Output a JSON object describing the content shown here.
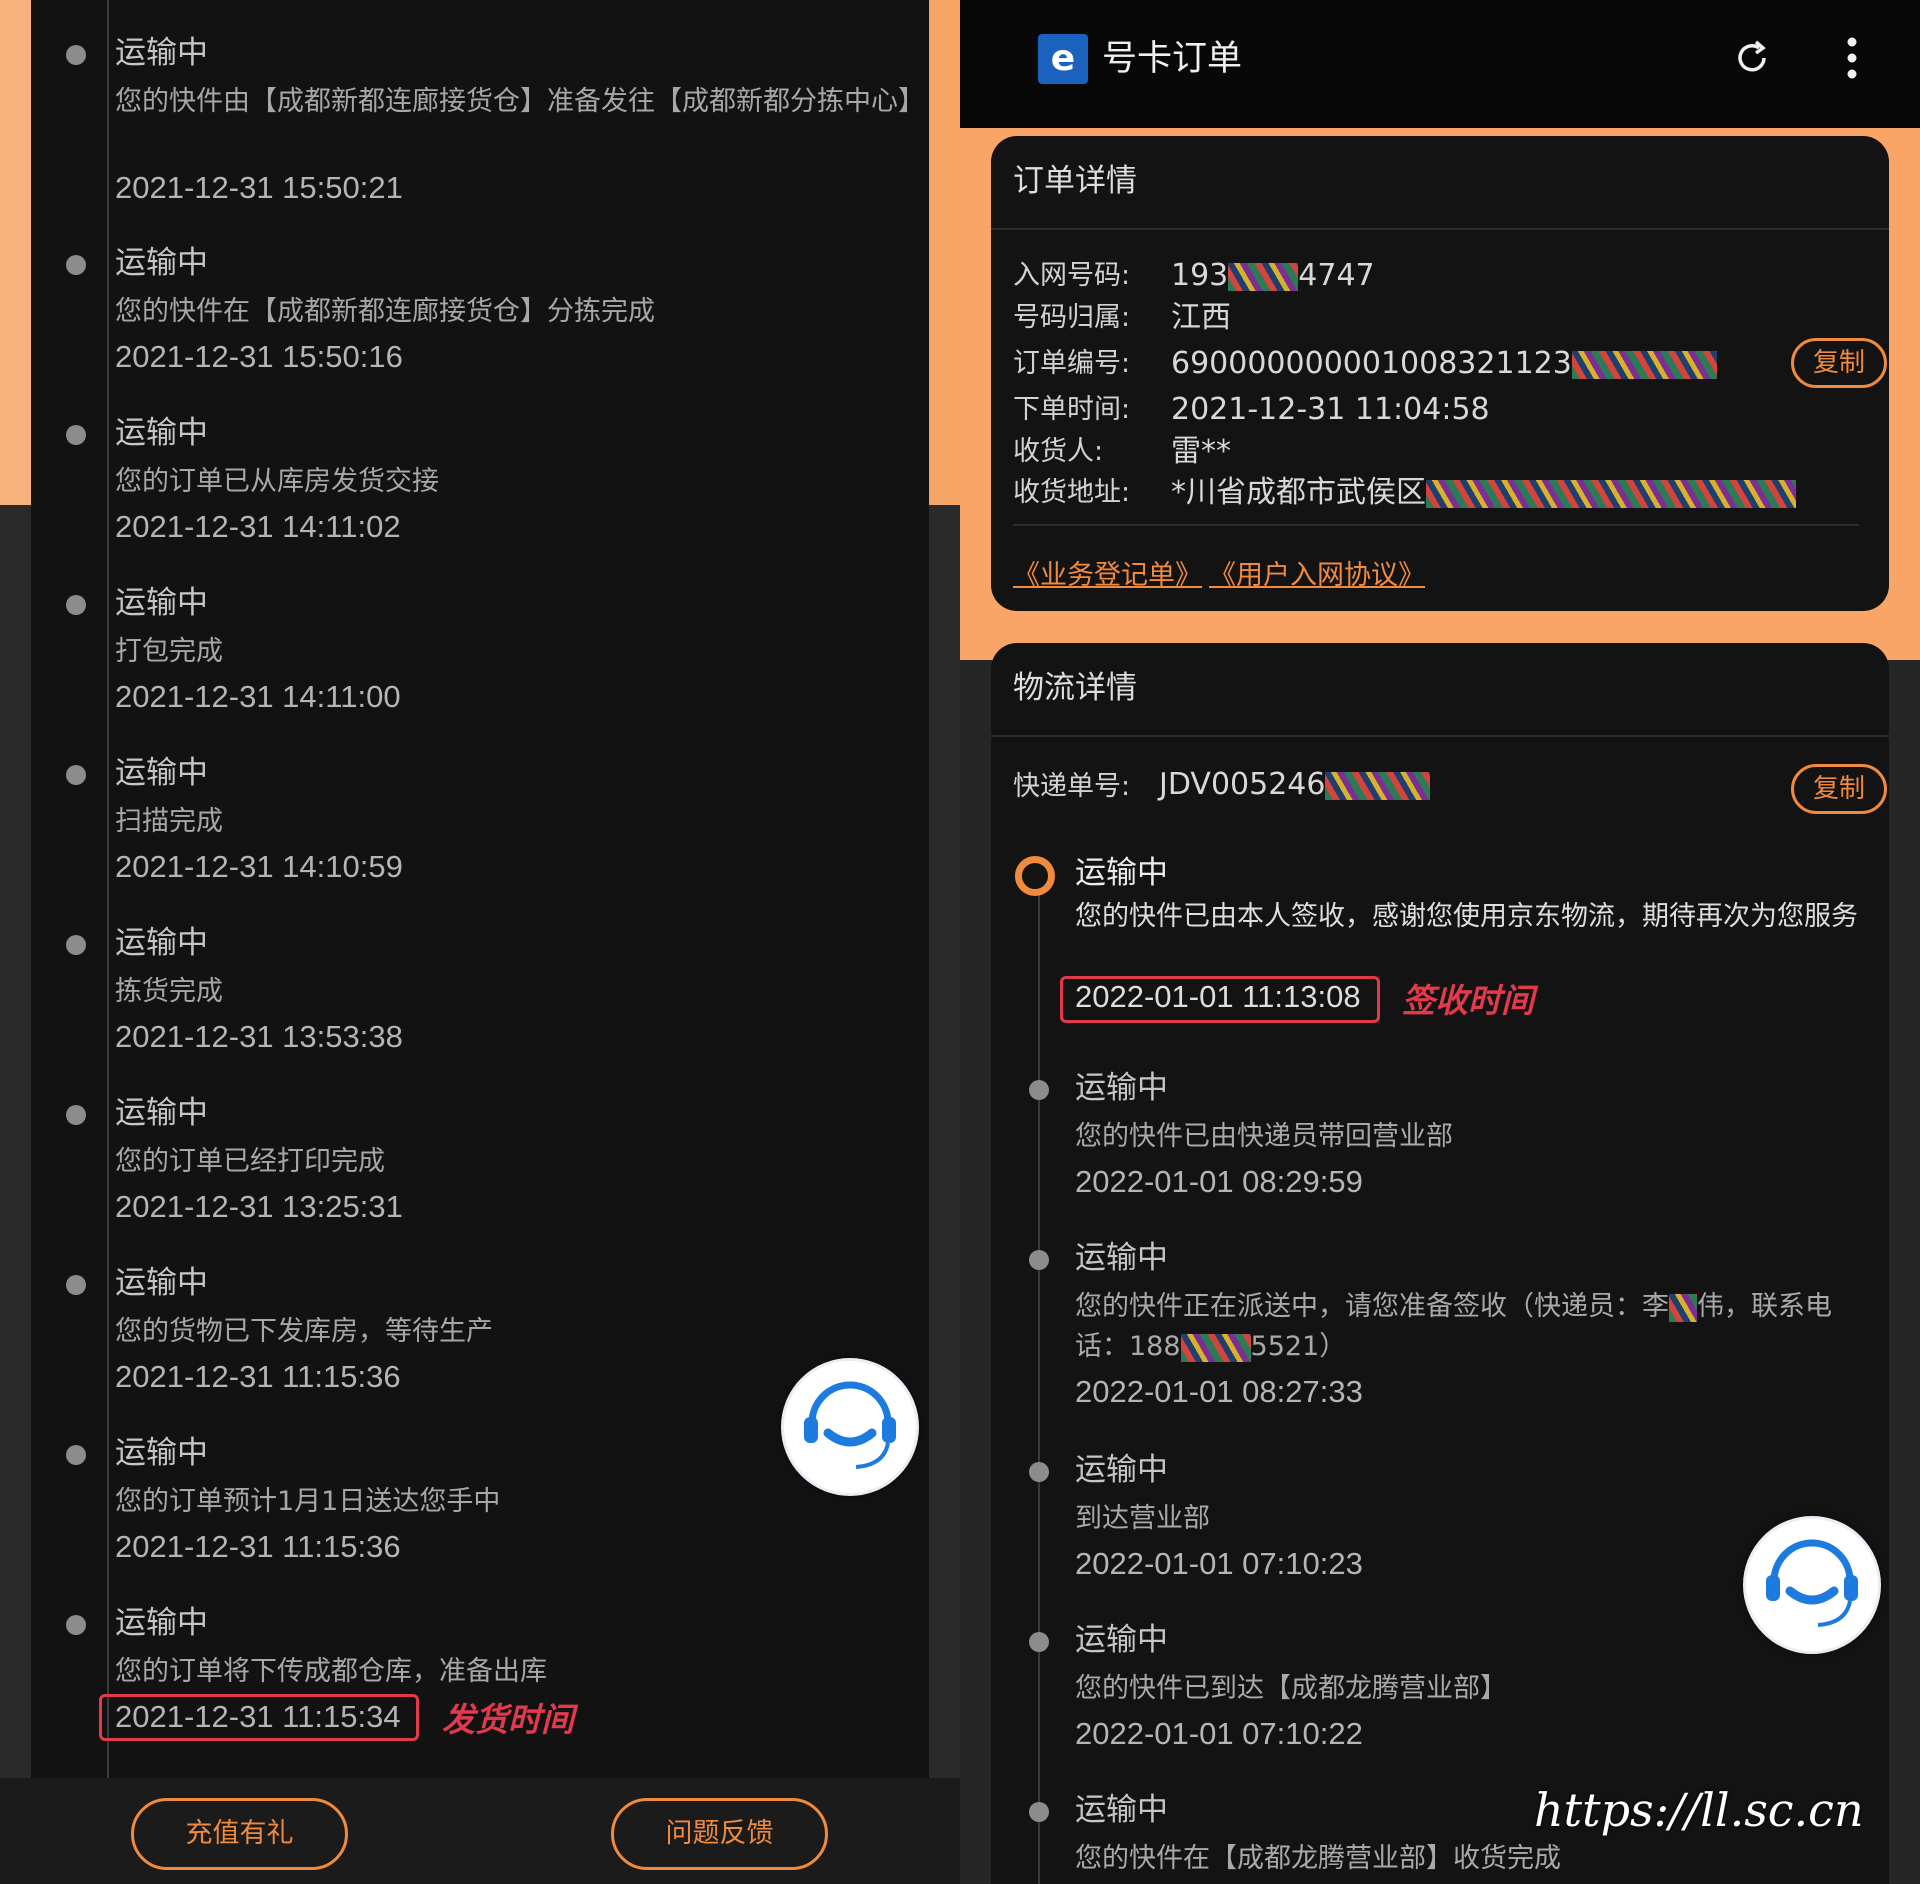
{
  "left": {
    "timeline": [
      {
        "status": "运输中",
        "desc": "您的快件由【成都新都连廊接货仓】准备发往【成都新都分拣中心】",
        "time": "2021-12-31 15:50:21"
      },
      {
        "status": "运输中",
        "desc": "您的快件在【成都新都连廊接货仓】分拣完成",
        "time": "2021-12-31 15:50:16"
      },
      {
        "status": "运输中",
        "desc": "您的订单已从库房发货交接",
        "time": "2021-12-31 14:11:02"
      },
      {
        "status": "运输中",
        "desc": "打包完成",
        "time": "2021-12-31 14:11:00"
      },
      {
        "status": "运输中",
        "desc": "扫描完成",
        "time": "2021-12-31 14:10:59"
      },
      {
        "status": "运输中",
        "desc": "拣货完成",
        "time": "2021-12-31 13:53:38"
      },
      {
        "status": "运输中",
        "desc": "您的订单已经打印完成",
        "time": "2021-12-31 13:25:31"
      },
      {
        "status": "运输中",
        "desc": "您的货物已下发库房，等待生产",
        "time": "2021-12-31 11:15:36"
      },
      {
        "status": "运输中",
        "desc": "您的订单预计1月1日送达您手中",
        "time": "2021-12-31 11:15:36"
      },
      {
        "status": "运输中",
        "desc": "您的订单将下传成都仓库，准备出库",
        "time": "2021-12-31 11:15:34"
      }
    ],
    "ship_note": "发货时间",
    "buttons": {
      "recharge": "充值有礼",
      "feedback": "问题反馈"
    }
  },
  "right": {
    "app_title": "号卡订单",
    "order": {
      "title": "订单详情",
      "phone_label": "入网号码:",
      "phone_prefix": "193",
      "phone_suffix": "4747",
      "region_label": "号码归属:",
      "region": "江西",
      "order_no_label": "订单编号:",
      "order_no": "690000000001008321123",
      "order_time_label": "下单时间:",
      "order_time": "2021-12-31 11:04:58",
      "receiver_label": "收货人:",
      "receiver": "雷**",
      "address_label": "收货地址:",
      "address": "*川省成都市武侯区",
      "copy": "复制",
      "link_business": "《业务登记单》",
      "link_agreement": "《用户入网协议》"
    },
    "logistics": {
      "title": "物流详情",
      "tracking_label": "快递单号:",
      "tracking_no": "JDV005246",
      "copy": "复制",
      "timeline": [
        {
          "status": "运输中",
          "desc": "您的快件已由本人签收，感谢您使用京东物流，期待再次为您服务",
          "time": "2022-01-01 11:13:08"
        },
        {
          "status": "运输中",
          "desc": "您的快件已由快递员带回营业部",
          "time": "2022-01-01 08:29:59"
        },
        {
          "status": "运输中",
          "desc_a": "您的快件正在派送中，请您准备签收（快递员：李",
          "desc_b": "伟，联系电话：188",
          "desc_c": "5521）",
          "time": "2022-01-01 08:27:33"
        },
        {
          "status": "运输中",
          "desc": "到达营业部",
          "time": "2022-01-01 07:10:23"
        },
        {
          "status": "运输中",
          "desc": "您的快件已到达【成都龙腾营业部】",
          "time": "2022-01-01 07:10:22"
        },
        {
          "status": "运输中",
          "desc": "您的快件在【成都龙腾营业部】收货完成",
          "time": ""
        }
      ],
      "sign_note": "签收时间"
    }
  },
  "watermark": "https://ll.sc.cn",
  "colors": {
    "accent": "#f08a3c",
    "highlight": "#e23a4c",
    "card": "#131313"
  }
}
